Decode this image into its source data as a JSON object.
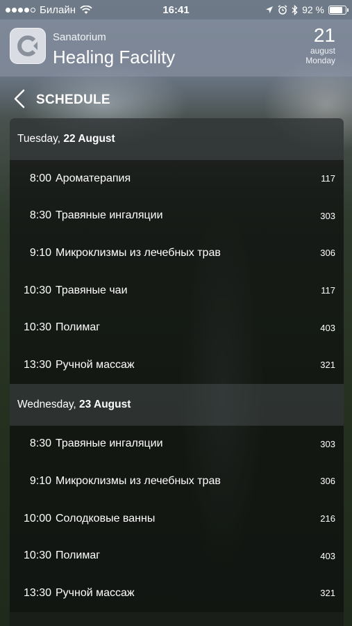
{
  "status_bar": {
    "carrier": "Билайн",
    "time": "16:41",
    "battery_text": "92 %",
    "battery_level": 0.92,
    "signal_bars": 4
  },
  "header": {
    "subtitle": "Sanatorium",
    "title": "Healing Facility",
    "date_day": "21",
    "date_month": "august",
    "date_weekday": "Monday"
  },
  "nav": {
    "title": "SCHEDULE"
  },
  "days": [
    {
      "prefix": "Tuesday, ",
      "date": "22 August",
      "items": [
        {
          "time": "8:00",
          "name": "Ароматерапия",
          "room": "117"
        },
        {
          "time": "8:30",
          "name": "Травяные ингаляции",
          "room": "303"
        },
        {
          "time": "9:10",
          "name": "Микроклизмы из лечебных трав",
          "room": "306"
        },
        {
          "time": "10:30",
          "name": "Травяные чаи",
          "room": "117"
        },
        {
          "time": "10:30",
          "name": "Полимаг",
          "room": "403"
        },
        {
          "time": "13:30",
          "name": "Ручной массаж",
          "room": "321"
        }
      ]
    },
    {
      "prefix": "Wednesday, ",
      "date": "23 August",
      "items": [
        {
          "time": "8:30",
          "name": "Травяные ингаляции",
          "room": "303"
        },
        {
          "time": "9:10",
          "name": "Микроклизмы из лечебных трав",
          "room": "306"
        },
        {
          "time": "10:00",
          "name": "Солодковые ванны",
          "room": "216"
        },
        {
          "time": "10:30",
          "name": "Полимаг",
          "room": "403"
        },
        {
          "time": "13:30",
          "name": "Ручной массаж",
          "room": "321"
        }
      ]
    }
  ]
}
